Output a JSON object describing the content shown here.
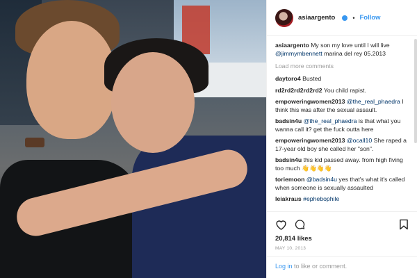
{
  "post": {
    "username": "asiaargento",
    "follow_label": "Follow",
    "separator": "•",
    "caption": {
      "user": "asiaargento",
      "text_before": "My son my love until I will live",
      "mention": "@jimmymbennett",
      "text_after": "marina del rey 05.2013"
    },
    "load_more": "Load more comments",
    "comments": [
      {
        "user": "daytoro4",
        "text": "Busted"
      },
      {
        "user": "rd2rd2rd2rd2rd2",
        "text": "You child rapist."
      },
      {
        "user": "empoweringwomen2013",
        "mention": "@the_real_phaedra",
        "text": "I think this was after the sexual assault."
      },
      {
        "user": "badsin4u",
        "mention": "@the_real_phaedra",
        "text": "is that what you wanna call it? get the fuck outta here"
      },
      {
        "user": "empoweringwomen2013",
        "mention": "@ocall10",
        "text": "She raped a 17-year old boy she called her \"son\"."
      },
      {
        "user": "badsin4u",
        "text": "this kid passed away. from high fiving too much 👋👋👋👋"
      },
      {
        "user": "toriemoon",
        "mention": "@badsin4u",
        "text": "yes that's what it's called when someone is sexually assaulted"
      },
      {
        "user": "leiakraus",
        "mention": "#ephebophile",
        "text": ""
      }
    ],
    "likes": "20,814 likes",
    "date": "MAY 10, 2013",
    "login": {
      "link": "Log in",
      "text": "to like or comment."
    },
    "icons": [
      "heart-icon",
      "comment-icon",
      "bookmark-icon"
    ]
  },
  "colors": {
    "link_blue": "#3897f0",
    "mention_blue": "#003569",
    "muted_gray": "#999999"
  }
}
